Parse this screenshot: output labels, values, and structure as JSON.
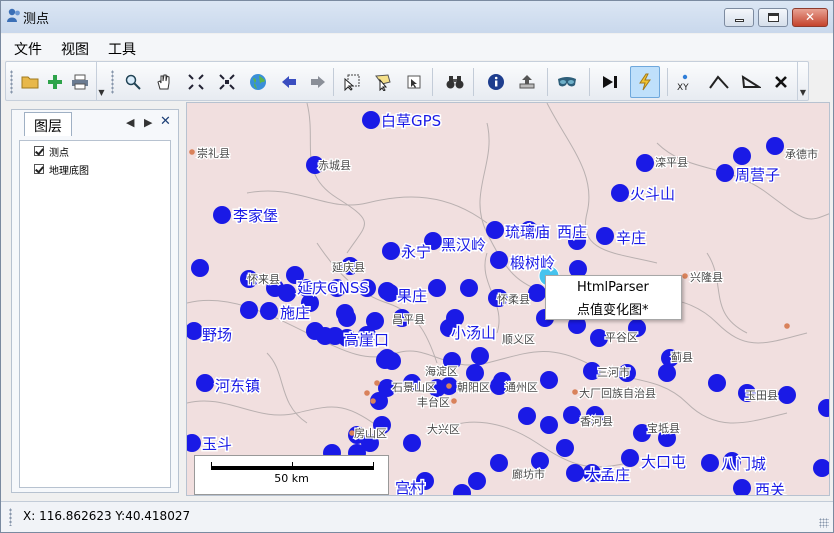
{
  "window": {
    "title": "测点"
  },
  "menu": {
    "items": [
      "文件",
      "视图",
      "工具"
    ]
  },
  "toolbar": {
    "icons": [
      "open-folder-icon",
      "add-icon",
      "print-icon",
      "zoom-icon",
      "pan-hand-icon",
      "zoom-in-extent-icon",
      "zoom-out-extent-icon",
      "full-extent-globe-icon",
      "back-arrow-icon",
      "forward-arrow-icon",
      "select-features-icon",
      "select-polygon-icon",
      "clear-selection-icon",
      "find-binoculars-icon",
      "identify-info-icon",
      "export-icon",
      "glasses-icon",
      "play-icon",
      "flash-icon",
      "xy-coordinate-icon",
      "measure-line-icon",
      "measure-area-icon",
      "delete-icon"
    ],
    "active": "flash-icon",
    "xy_label": "XY"
  },
  "panel": {
    "tab_label": "图层",
    "layers": [
      {
        "name": "测点",
        "checked": true
      },
      {
        "name": "地理底图",
        "checked": true
      }
    ]
  },
  "map": {
    "point_color": "#1a1ae6",
    "highlight_color": "#46c3ee",
    "city_dot_color": "#d9825b",
    "station_labels": [
      "白草GPS",
      "李家堡",
      "火斗山",
      "周营子",
      "琉璃庙",
      "西庄",
      "辛庄",
      "永宁",
      "黑汉岭",
      "椴树岭",
      "延庆GNSS",
      "果庄",
      "施庄",
      "小汤山",
      "高崖口",
      "野场",
      "河东镇",
      "玉斗",
      "大口屯",
      "八门城",
      "大孟庄",
      "西关",
      "宫村"
    ],
    "city_labels": [
      "崇礼县",
      "赤城县",
      "滦平县",
      "承德市",
      "延庆县",
      "怀来县",
      "怀柔县",
      "兴隆县",
      "昌平县",
      "顺义区",
      "平谷区",
      "蓟县",
      "三河市",
      "海淀区",
      "石景山区",
      "朝阳区",
      "通州区",
      "丰台区",
      "大厂回族自治县",
      "玉田县",
      "房山区",
      "大兴区",
      "香河县",
      "宝坻县",
      "廊坊市"
    ]
  },
  "scalebar": {
    "label": "50 km"
  },
  "context_menu": {
    "items": [
      "HtmlParser",
      "点值变化图*"
    ]
  },
  "status": {
    "coords": "X: 116.862623 Y:40.418027"
  }
}
